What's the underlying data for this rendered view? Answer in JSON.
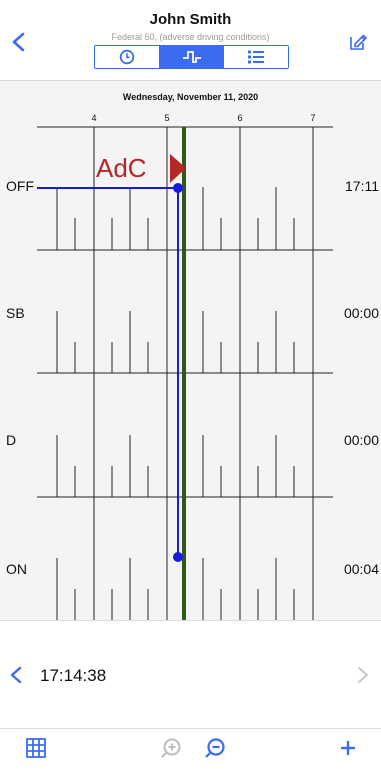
{
  "header": {
    "driver_name": "John Smith",
    "ruleset": "Federal 60, (adverse driving conditions)",
    "view_tabs": [
      "clock-icon",
      "graph-icon",
      "list-icon"
    ],
    "active_tab": 1
  },
  "graph": {
    "date": "Wednesday, November 11, 2020",
    "hour_ticks": [
      "4",
      "5",
      "6",
      "7"
    ],
    "rows": [
      {
        "status": "OFF",
        "duration": "17:11"
      },
      {
        "status": "SB",
        "duration": "00:00"
      },
      {
        "status": "D",
        "duration": "00:00"
      },
      {
        "status": "ON",
        "duration": "00:04"
      }
    ],
    "annotation": "AdC",
    "colors": {
      "duty_line": "#1a1adb",
      "current_marker": "#2e5a17",
      "annotation": "#b52626",
      "accent": "#3b6cf0"
    }
  },
  "navigator": {
    "current_time": "17:14:38"
  },
  "toolbar": {
    "items": [
      "grid-icon",
      "zoom-in-icon",
      "zoom-out-icon",
      "add-icon"
    ]
  }
}
